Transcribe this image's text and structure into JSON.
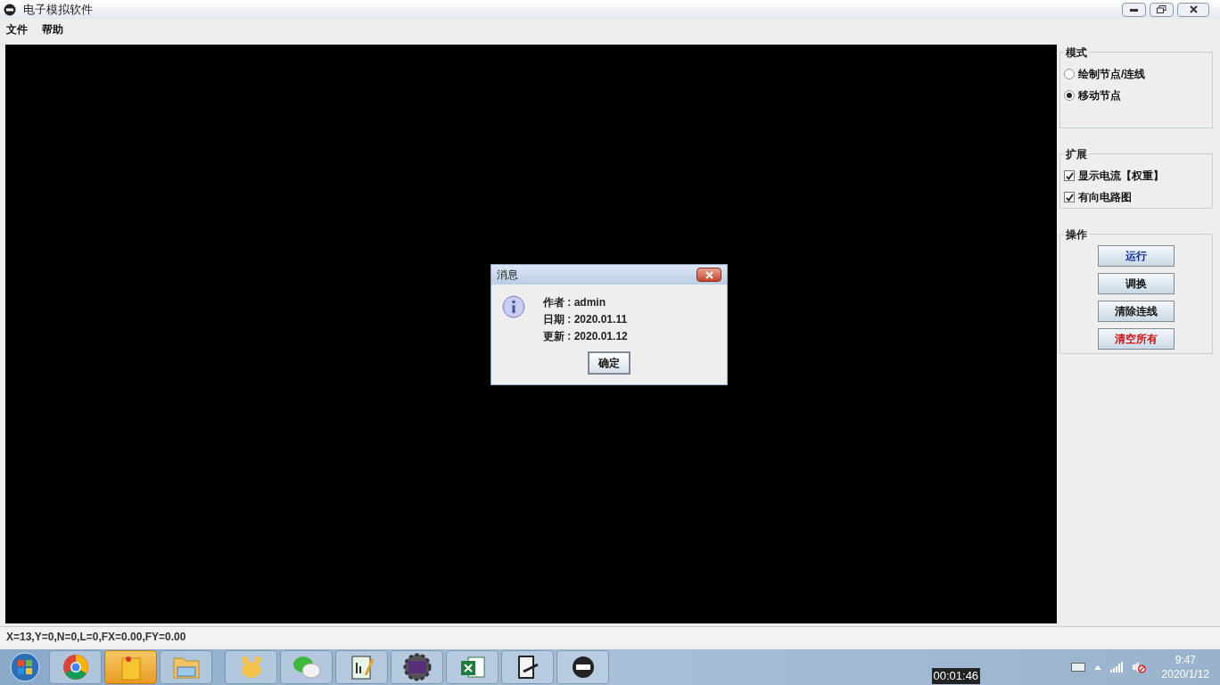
{
  "window": {
    "title": "电子模拟软件"
  },
  "menu": [
    "文件",
    "帮助"
  ],
  "mode_group": {
    "title": "模式",
    "options": [
      {
        "label": "绘制节点/连线",
        "selected": false
      },
      {
        "label": "移动节点",
        "selected": true
      }
    ]
  },
  "extension_group": {
    "title": "扩展",
    "options": [
      {
        "label": "显示电流【权重】",
        "checked": true
      },
      {
        "label": "有向电路图",
        "checked": true
      }
    ]
  },
  "operation_group": {
    "title": "操作",
    "buttons": [
      {
        "label": "运行",
        "color": "#0a2a9a"
      },
      {
        "label": "调换",
        "color": "#111111"
      },
      {
        "label": "清除连线",
        "color": "#111111"
      },
      {
        "label": "清空所有",
        "color": "#d01010"
      }
    ]
  },
  "status_bar": "X=13,Y=0,N=0,L=0,FX=0.00,FY=0.00",
  "dialog": {
    "title": "消息",
    "lines": [
      "作者 : admin",
      "日期 : 2020.01.11",
      "更新 : 2020.01.12"
    ],
    "button": "确定"
  },
  "taskbar": {
    "apps": [
      {
        "kind": "browser",
        "active": false
      },
      {
        "kind": "note",
        "active": true
      },
      {
        "kind": "folder",
        "active": false
      },
      {
        "kind": "paw",
        "active": false
      },
      {
        "kind": "chat",
        "active": false
      },
      {
        "kind": "notepad",
        "active": false
      },
      {
        "kind": "gear",
        "active": false
      },
      {
        "kind": "sheet",
        "active": false
      },
      {
        "kind": "doc",
        "active": false
      },
      {
        "kind": "app",
        "active": false
      }
    ],
    "timer": "00:01:46",
    "clock_time": "9:47",
    "clock_date": "2020/1/12"
  }
}
